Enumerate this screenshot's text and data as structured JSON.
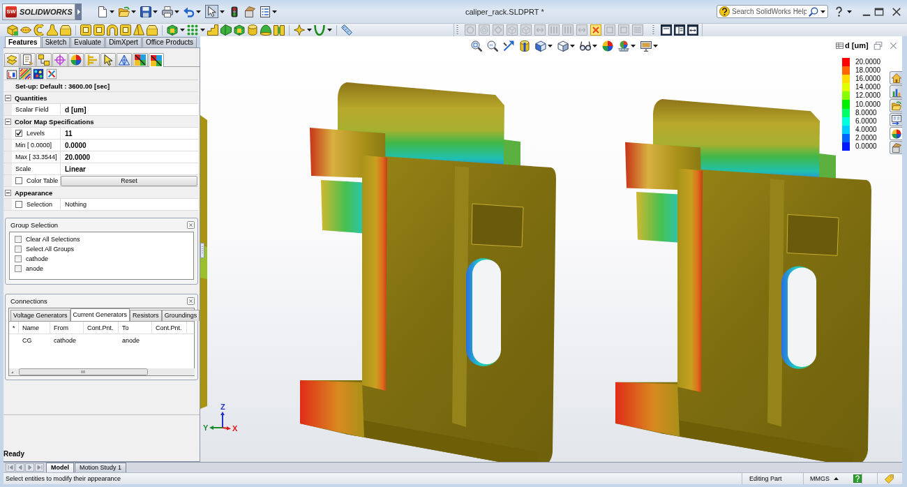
{
  "window": {
    "logo_badge": "SW",
    "logo": "SOLIDWORKS",
    "title": "caliper_rack.SLDPRT *",
    "search": {
      "placeholder": "Search SolidWorks Help"
    }
  },
  "quick_access": {
    "select_tool": {
      "selected": true
    }
  },
  "view_tools": [
    {
      "disabled": true,
      "on": false
    },
    {
      "disabled": true,
      "on": false
    },
    {
      "disabled": true,
      "on": false
    },
    {
      "disabled": true,
      "on": false
    },
    {
      "disabled": true,
      "on": false
    },
    {
      "disabled": true,
      "on": false
    },
    {
      "disabled": true,
      "on": false
    },
    {
      "disabled": true,
      "on": false
    },
    {
      "disabled": true,
      "on": false
    },
    {
      "disabled": false,
      "on": true
    },
    {
      "disabled": true,
      "on": false
    },
    {
      "disabled": true,
      "on": false
    },
    {
      "disabled": true,
      "on": false
    }
  ],
  "command_tabs": [
    {
      "label": "Features",
      "selected": true
    },
    {
      "label": "Sketch",
      "selected": false
    },
    {
      "label": "Evaluate",
      "selected": false
    },
    {
      "label": "DimXpert",
      "selected": false
    },
    {
      "label": "Office Products",
      "selected": false
    }
  ],
  "manager_tabs": [
    {
      "selected": false
    },
    {
      "selected": false
    },
    {
      "selected": false
    },
    {
      "selected": false
    },
    {
      "selected": false
    },
    {
      "selected": false
    },
    {
      "selected": false
    },
    {
      "selected": false
    },
    {
      "selected": false
    },
    {
      "selected": true
    }
  ],
  "result_tools": [
    {
      "selected": false
    },
    {
      "selected": true
    },
    {
      "selected": false
    },
    {
      "selected": false
    }
  ],
  "property_manager": {
    "setup": "Set-up: Default : 3600.00 [sec]",
    "sections": [
      {
        "title": "Quantities",
        "expanded": true,
        "rows": [
          {
            "kind": "plain",
            "label": "Scalar Field",
            "value": "d [um]"
          }
        ]
      },
      {
        "title": "Color Map Specifications",
        "expanded": true,
        "rows": [
          {
            "kind": "check",
            "label": "Levels",
            "checked": true,
            "value": "11"
          },
          {
            "kind": "plain",
            "label": "Min [ 0.0000]",
            "value": "0.0000"
          },
          {
            "kind": "plain",
            "label": "Max [ 33.3544]",
            "value": "20.0000"
          },
          {
            "kind": "plain",
            "label": "Scale",
            "value": "Linear"
          },
          {
            "kind": "check",
            "label": "Color Table",
            "checked": false,
            "button": "Reset"
          }
        ]
      },
      {
        "title": "Appearance",
        "expanded": true,
        "rows": [
          {
            "kind": "check",
            "label": "Selection",
            "checked": false,
            "placeholder": "Nothing"
          }
        ]
      }
    ]
  },
  "group_selection": {
    "title": "Group Selection",
    "items": [
      {
        "label": "Clear All Selections",
        "checked": false
      },
      {
        "label": "Select All Groups",
        "checked": false
      },
      {
        "label": "cathode",
        "checked": false
      },
      {
        "label": "anode",
        "checked": false
      }
    ]
  },
  "connections": {
    "title": "Connections",
    "tabs": [
      {
        "label": "Voltage Generators",
        "selected": false
      },
      {
        "label": "Current Generators",
        "selected": true
      },
      {
        "label": "Resistors",
        "selected": false
      },
      {
        "label": "Groundings",
        "selected": false
      }
    ],
    "table": {
      "columns": [
        "*",
        "Name",
        "From",
        "Cont.Pnt.",
        "To",
        "Cont.Pnt."
      ],
      "rows": [
        [
          null,
          "CG",
          "cathode",
          null,
          "anode",
          null
        ]
      ]
    }
  },
  "manager_status": "Ready",
  "viewport": {
    "legend": {
      "title": "d [um]",
      "entries": [
        {
          "label": "20.0000",
          "color": "#ff0000"
        },
        {
          "label": "18.0000",
          "color": "#ff6600"
        },
        {
          "label": "16.0000",
          "color": "#ffdd00"
        },
        {
          "label": "14.0000",
          "color": "#e0ff00"
        },
        {
          "label": "12.0000",
          "color": "#88ff00"
        },
        {
          "label": "10.0000",
          "color": "#00ee00"
        },
        {
          "label": "8.0000",
          "color": "#00ff66"
        },
        {
          "label": "6.0000",
          "color": "#00ffdd"
        },
        {
          "label": "4.0000",
          "color": "#00ccff"
        },
        {
          "label": "2.0000",
          "color": "#0066ff"
        },
        {
          "label": "0.0000",
          "color": "#0018ff"
        }
      ]
    },
    "triad": [
      {
        "label": "Z",
        "color": "#2233cc"
      },
      {
        "label": "Y",
        "color": "#1e8a2e"
      },
      {
        "label": "X",
        "color": "#dd1818"
      }
    ],
    "task_pane": [
      {
        "selected": false
      },
      {
        "selected": false
      },
      {
        "selected": false
      },
      {
        "selected": false
      },
      {
        "selected": true
      },
      {
        "selected": false
      }
    ]
  },
  "document_tabs": [
    {
      "label": "Model",
      "selected": true
    },
    {
      "label": "Motion Study 1",
      "selected": false
    }
  ],
  "status_bar": {
    "message": "Select entities to modify their appearance",
    "mode": "Editing Part",
    "units": "MMGS"
  }
}
